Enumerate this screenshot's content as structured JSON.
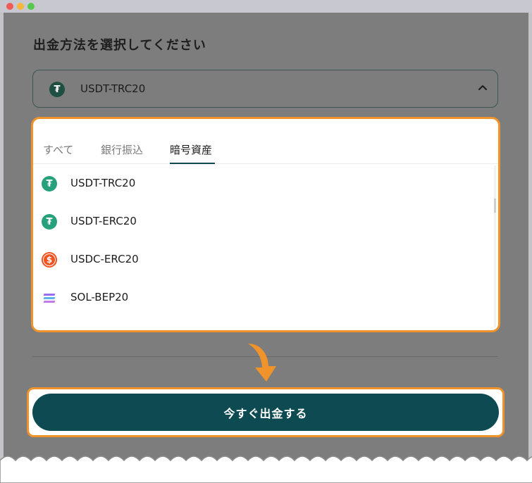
{
  "page": {
    "heading": "出金方法を選択してください"
  },
  "select": {
    "value": "USDT-TRC20",
    "icon": "tether-icon"
  },
  "tabs": [
    {
      "label": "すべて",
      "active": false
    },
    {
      "label": "銀行振込",
      "active": false
    },
    {
      "label": "暗号資産",
      "active": true
    }
  ],
  "options": [
    {
      "label": "USDT-TRC20",
      "icon": "tether-icon"
    },
    {
      "label": "USDT-ERC20",
      "icon": "tether-icon"
    },
    {
      "label": "USDC-ERC20",
      "icon": "usdc-icon"
    },
    {
      "label": "SOL-BEP20",
      "icon": "solana-icon"
    }
  ],
  "actions": {
    "withdraw_label": "今すぐ出金する"
  },
  "colors": {
    "primary": "#0d4a52",
    "highlight": "#f0932b",
    "tether": "#26a17b",
    "usdc": "#f4521f",
    "overlay": "#7d7d7d"
  }
}
